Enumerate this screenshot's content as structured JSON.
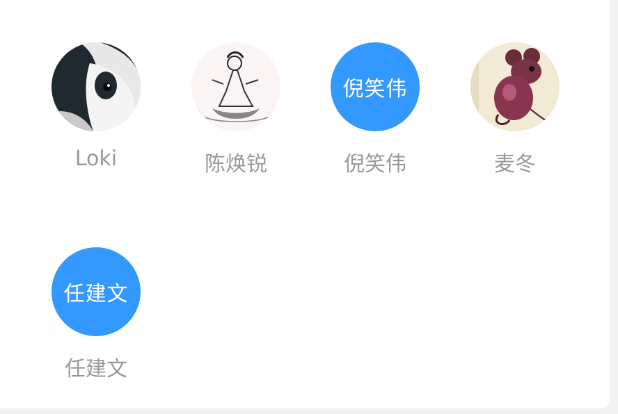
{
  "members": [
    {
      "name": "Loki",
      "avatar": {
        "kind": "photo",
        "icon": "rabbit-photo-icon"
      }
    },
    {
      "name": "陈焕锐",
      "avatar": {
        "kind": "photo",
        "icon": "ink-figure-photo-icon"
      }
    },
    {
      "name": "倪笑伟",
      "avatar": {
        "kind": "text",
        "text": "倪笑伟"
      }
    },
    {
      "name": "麦冬",
      "avatar": {
        "kind": "photo",
        "icon": "mouse-stamp-photo-icon"
      }
    },
    {
      "name": "任建文",
      "avatar": {
        "kind": "text",
        "text": "任建文"
      }
    }
  ],
  "colors": {
    "avatar_bg": "#3399ff",
    "name_text": "#999999",
    "avatar_text": "#ffffff",
    "background": "#f2f2f2",
    "card": "#ffffff"
  }
}
